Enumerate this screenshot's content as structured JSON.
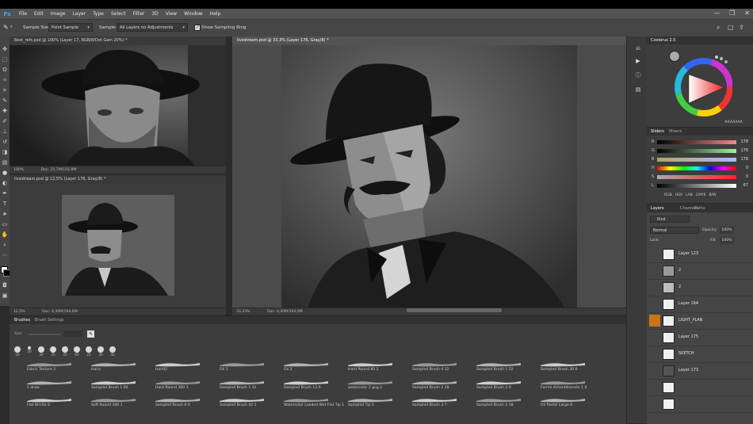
{
  "app": {
    "menu": [
      "File",
      "Edit",
      "Image",
      "Layer",
      "Type",
      "Select",
      "Filter",
      "3D",
      "View",
      "Window",
      "Help"
    ],
    "window_controls": [
      "—",
      "❐",
      "✕"
    ]
  },
  "options": {
    "sample_size_label": "Sample Size:",
    "sample_size_value": "Point Sample",
    "sample_label": "Sample:",
    "sample_value": "All Layers no Adjustments",
    "show_ring_label": "Show Sampling Ring"
  },
  "documents": {
    "ref1": {
      "tab": "Best_refs.psd @ 100% (Layer 17, RGB/8/Dot Gain 20%) *",
      "zoom": "100%",
      "doc": "Doc: 25,7M/155,8M"
    },
    "ref2": {
      "tab": "livestream.psd @ 12,5% (Layer 176, Gray/8) *",
      "zoom": "12,5%",
      "doc": "Doc: 4,30M/194,6M"
    },
    "main": {
      "tab": "livestream.psd @ 33,3% (Layer 176, Gray/8) *",
      "zoom": "33,33%",
      "doc": "Doc: 4,30M/194,6M"
    }
  },
  "color_panel": {
    "tab": "Coolorus 2.5",
    "hex": "#AAAAAA"
  },
  "sliders_panel": {
    "tabs": [
      "Sliders",
      "Mixers"
    ],
    "rows": [
      {
        "label": "R",
        "value": "178",
        "gradient": "linear-gradient(90deg,#000,#f08a8a)"
      },
      {
        "label": "G",
        "value": "178",
        "gradient": "linear-gradient(90deg,#4a6,#a5f0a5)"
      },
      {
        "label": "B",
        "value": "178",
        "gradient": "linear-gradient(90deg,#aa6,#b5b5ff)"
      },
      {
        "label": "H",
        "value": "0",
        "gradient": "linear-gradient(90deg,red,yellow,lime,cyan,blue,magenta,red)"
      },
      {
        "label": "S",
        "value": "0",
        "gradient": "linear-gradient(90deg,#aaa,#f22)"
      },
      {
        "label": "L",
        "value": "67",
        "gradient": "linear-gradient(90deg,#000,#fff)"
      }
    ],
    "modes": [
      "RGB",
      "HSV",
      "LAB",
      "CMYK",
      "B/W"
    ]
  },
  "layers_panel": {
    "tabs": [
      "Layers",
      "Channels",
      "Paths"
    ],
    "filter": "Kind",
    "blend_mode": "Normal",
    "opacity_label": "Opacity:",
    "opacity": "100%",
    "lock_label": "Lock:",
    "fill_label": "Fill:",
    "fill": "100%",
    "layers": [
      {
        "name": "Layer 123"
      },
      {
        "name": "2"
      },
      {
        "name": "2"
      },
      {
        "name": "Layer 164"
      },
      {
        "name": "LIGHT_PLAN"
      },
      {
        "name": "Layer 175"
      },
      {
        "name": "SKETCH"
      },
      {
        "name": "Layer 173"
      }
    ]
  },
  "brushes_panel": {
    "tabs": [
      "Brushes",
      "Brush Settings"
    ],
    "size_label": "Size",
    "presets": [
      "20",
      "20",
      "30",
      "35",
      "45",
      "65",
      "25",
      "30",
      "40"
    ],
    "brushes": [
      [
        "Fabric Texture 2",
        "Hairy",
        "Hair02",
        "Oil 1",
        "Oil 2",
        "Hard Round 80 2",
        "Sampled Brush 4 12",
        "Sampled Brush 1 52",
        "Sampled Brush 30 6"
      ],
      [
        "1 draw",
        "Sampled Brush 1 90",
        "Hard Round 300 1",
        "Sampled Brush 1 31",
        "Sampled Brush 13 9",
        "watercolor 2 gcg 2",
        "Sampled Brush 2 28",
        "Sampled Brush 2 9",
        "Forme échantillonnée 1 6"
      ],
      [
        "Flat Bristle 6",
        "Soft Round 300 1",
        "Sampled Brush 8 9",
        "Sampled Brush 42 1",
        "Watercolor Loaded Wet Flat Tip 1",
        "Sampled Tip 5",
        "Sampled Brush 3 7",
        "Sampled Brush 3 18",
        "Oil Pastel Large 8"
      ]
    ]
  }
}
